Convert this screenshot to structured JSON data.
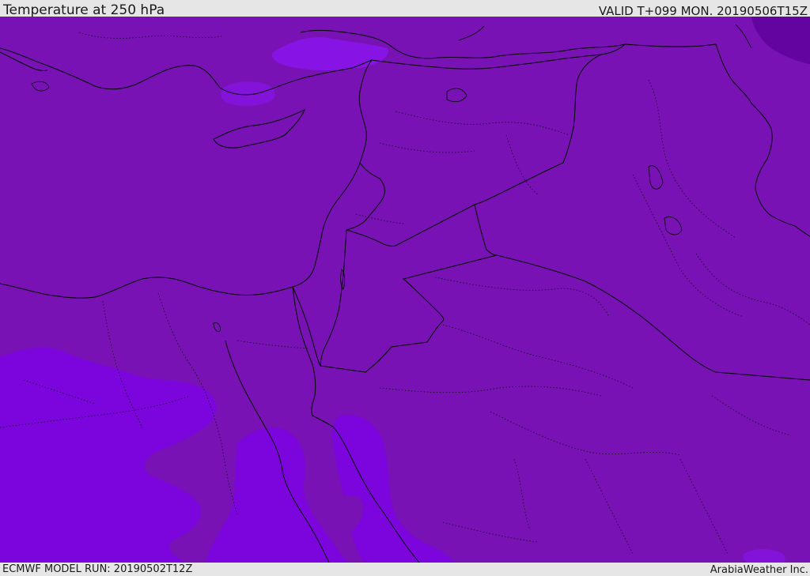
{
  "header": {
    "title": "Temperature at 250 hPa",
    "valid_time": "VALID T+099 MON. 20190506T15Z"
  },
  "footer": {
    "model_run": "ECMWF MODEL RUN: 20190502T12Z",
    "credit": "ArabiaWeather Inc."
  },
  "map": {
    "colors": {
      "base_field": "#7812b4",
      "cold_field": "#7c04dc",
      "colder_field": "#8c14f4",
      "warm_patch": "#6404a0",
      "coastline": "#000000",
      "border": "#000000"
    }
  }
}
